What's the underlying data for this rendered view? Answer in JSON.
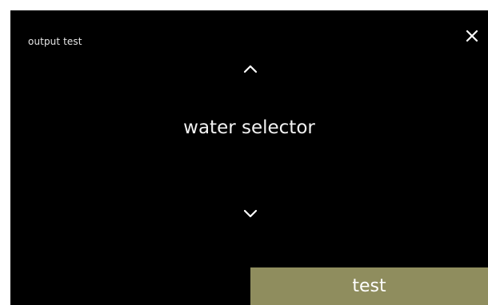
{
  "screen": {
    "title": "output test",
    "close_icon": "close-icon"
  },
  "selector": {
    "up_icon": "chevron-up-icon",
    "current_item": "water selector",
    "down_icon": "chevron-down-icon"
  },
  "actions": {
    "test_label": "test"
  },
  "colors": {
    "background": "#000000",
    "frame": "#ffffff",
    "text": "#ffffff",
    "test_button": "#8f8d5e"
  }
}
